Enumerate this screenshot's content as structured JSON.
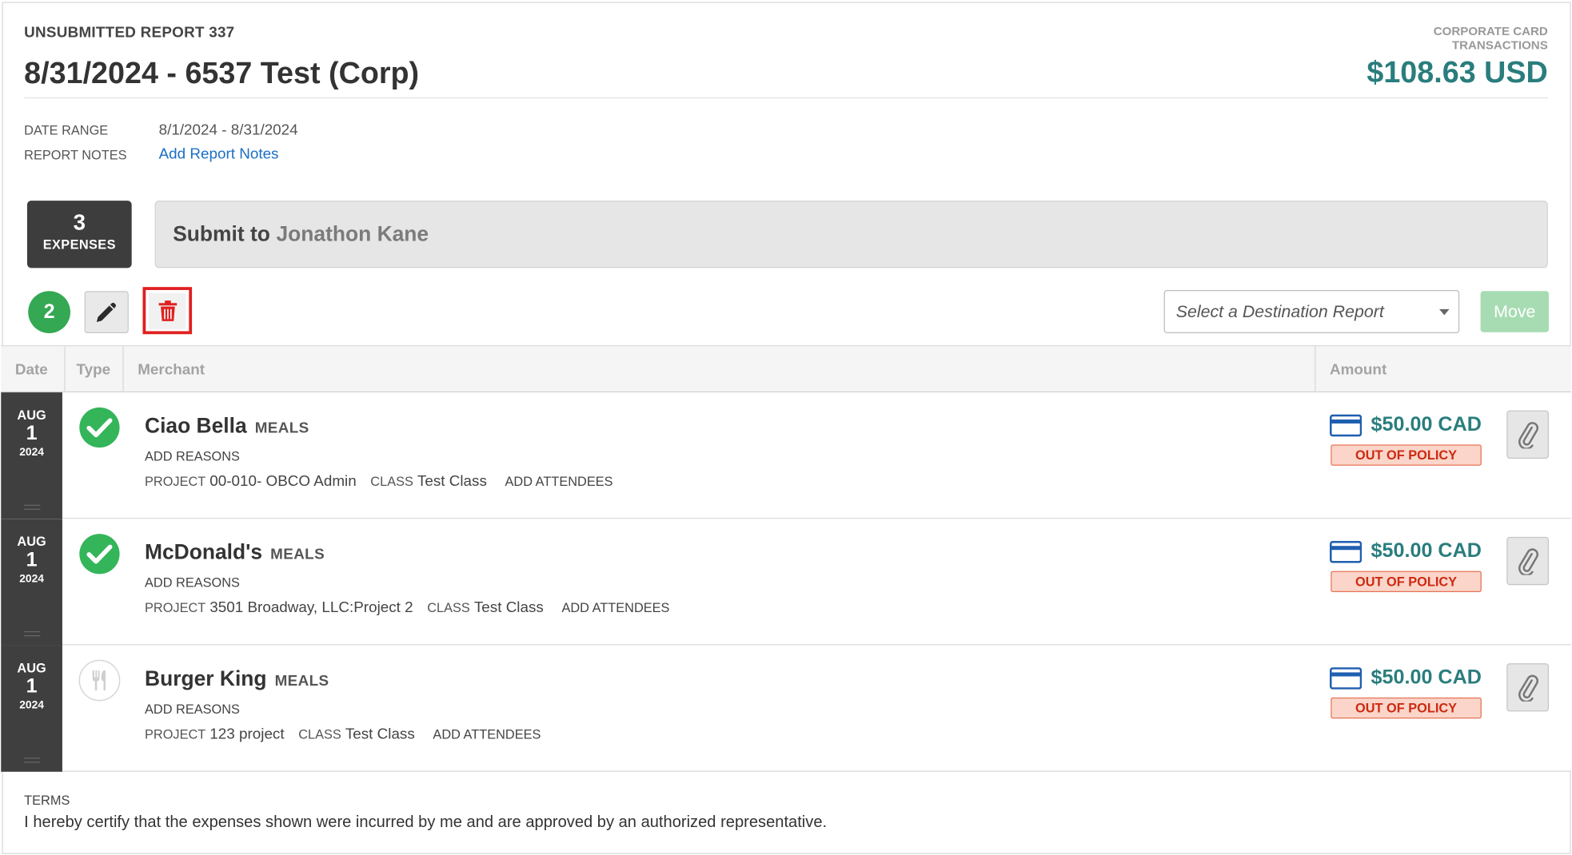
{
  "header": {
    "report_number": "UNSUBMITTED REPORT 337",
    "title": "8/31/2024 - 6537 Test (Corp)",
    "corp_label_line1": "CORPORATE CARD",
    "corp_label_line2": "TRANSACTIONS",
    "total": "$108.63 USD"
  },
  "meta": {
    "date_range_label": "DATE RANGE",
    "date_range_value": "8/1/2024 - 8/31/2024",
    "report_notes_label": "REPORT NOTES",
    "report_notes_link": "Add Report Notes"
  },
  "summary": {
    "expense_count": "3",
    "expense_label": "EXPENSES",
    "submit_prefix": "Submit to",
    "approver": "Jonathon Kane"
  },
  "toolbar": {
    "selected_count": "2",
    "destination_placeholder": "Select a Destination Report",
    "move_label": "Move"
  },
  "table": {
    "headers": {
      "date": "Date",
      "type": "Type",
      "merchant": "Merchant",
      "amount": "Amount"
    },
    "rows": [
      {
        "month": "AUG",
        "day": "1",
        "year": "2024",
        "merchant": "Ciao Bella",
        "category": "MEALS",
        "reasons": "ADD REASONS",
        "project_label": "PROJECT",
        "project": "00-010- OBCO Admin",
        "class_label": "CLASS",
        "class": "Test Class",
        "attendees": "ADD ATTENDEES",
        "amount": "$50.00 CAD",
        "policy": "OUT OF POLICY",
        "type_icon": "check-circle-icon"
      },
      {
        "month": "AUG",
        "day": "1",
        "year": "2024",
        "merchant": "McDonald's",
        "category": "MEALS",
        "reasons": "ADD REASONS",
        "project_label": "PROJECT",
        "project": "3501 Broadway, LLC:Project 2",
        "class_label": "CLASS",
        "class": "Test Class",
        "attendees": "ADD ATTENDEES",
        "amount": "$50.00 CAD",
        "policy": "OUT OF POLICY",
        "type_icon": "check-circle-icon"
      },
      {
        "month": "AUG",
        "day": "1",
        "year": "2024",
        "merchant": "Burger King",
        "category": "MEALS",
        "reasons": "ADD REASONS",
        "project_label": "PROJECT",
        "project": "123 project",
        "class_label": "CLASS",
        "class": "Test Class",
        "attendees": "ADD ATTENDEES",
        "amount": "$50.00 CAD",
        "policy": "OUT OF POLICY",
        "type_icon": "fork-knife-icon"
      }
    ]
  },
  "terms": {
    "label": "TERMS",
    "text": "I hereby certify that the expenses shown were incurred by me and are approved by an authorized representative."
  },
  "colors": {
    "accent_teal": "#2a7d7d",
    "link_blue": "#1a6fc4",
    "success_green": "#34a853",
    "danger_red": "#e02020",
    "card_blue": "#1f5fb0"
  }
}
